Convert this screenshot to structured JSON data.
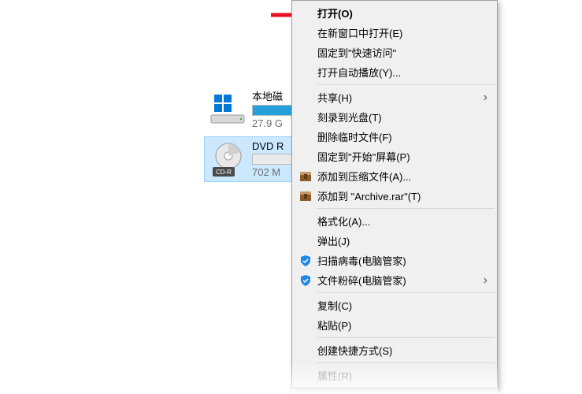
{
  "drives": {
    "local": {
      "name": "本地磁",
      "sub": "27.9 G",
      "fill_pct": 55
    },
    "dvd": {
      "name": "DVD R",
      "sub": "702 M",
      "badge": "CD-R",
      "fill_pct": 0
    }
  },
  "menu": {
    "open": "打开(O)",
    "open_new_window": "在新窗口中打开(E)",
    "pin_quick_access": "固定到\"快速访问\"",
    "open_autoplay": "打开自动播放(Y)...",
    "share": "共享(H)",
    "burn_to_disc": "刻录到光盘(T)",
    "delete_temp": "删除临时文件(F)",
    "pin_start": "固定到\"开始\"屏幕(P)",
    "add_to_archive": "添加到压缩文件(A)...",
    "add_to_named": "添加到 \"Archive.rar\"(T)",
    "format": "格式化(A)...",
    "eject": "弹出(J)",
    "scan_virus": "扫描病毒(电脑管家)",
    "file_shred": "文件粉碎(电脑管家)",
    "copy": "复制(C)",
    "paste": "粘贴(P)",
    "create_shortcut": "创建快捷方式(S)",
    "properties": "属性(R)"
  }
}
